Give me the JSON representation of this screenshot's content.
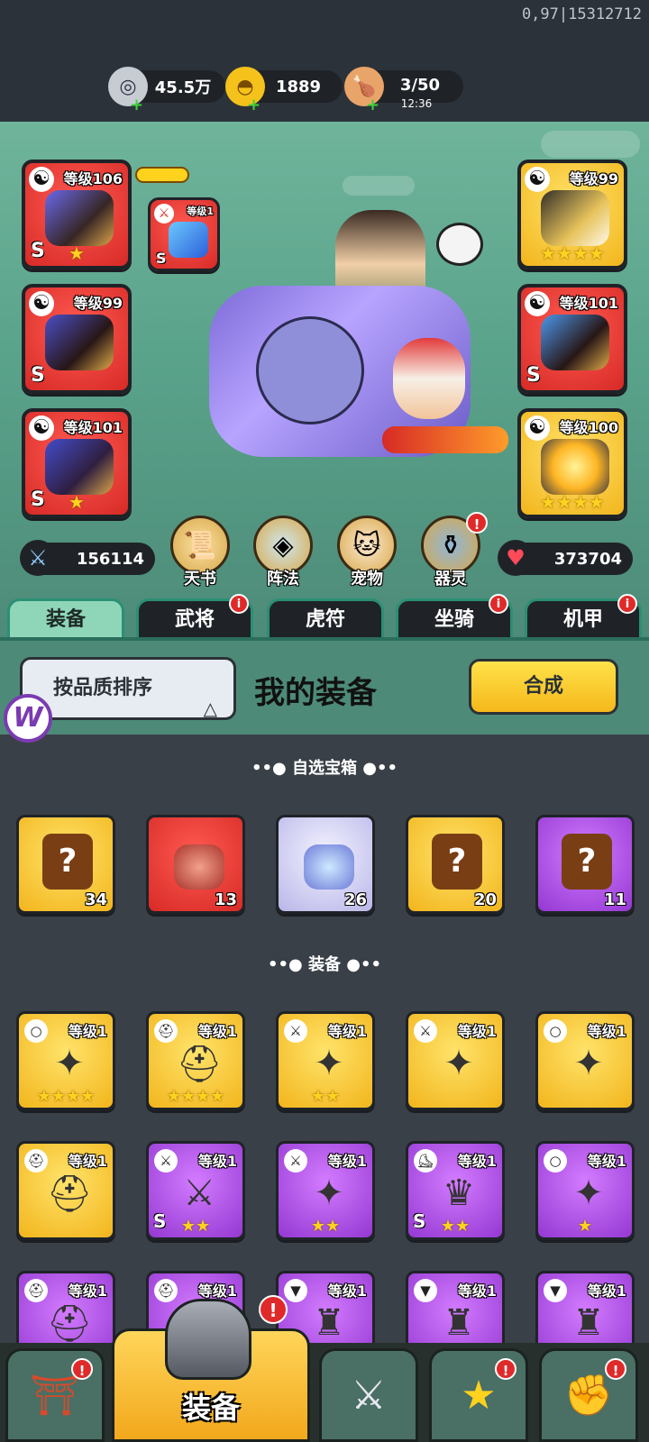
{
  "debug_text": "0,97|15312712",
  "resources": [
    {
      "icon": "coin-icon",
      "value": "45.5万"
    },
    {
      "icon": "gold-ingot-icon",
      "value": "1889"
    },
    {
      "icon": "drumstick-icon",
      "value": "3/50",
      "sub": "12:36"
    }
  ],
  "equip_slots_left": [
    {
      "level": "等级106",
      "grade": "S",
      "stars": "★",
      "color": "red"
    },
    {
      "level": "等级99",
      "grade": "S",
      "stars": "",
      "color": "red"
    },
    {
      "level": "等级101",
      "grade": "S",
      "stars": "★",
      "color": "red"
    }
  ],
  "small_slot": {
    "level": "等级1",
    "grade": "S"
  },
  "equip_slots_right": [
    {
      "level": "等级99",
      "grade": "",
      "stars": "★★★★",
      "color": "gold"
    },
    {
      "level": "等级101",
      "grade": "S",
      "stars": "",
      "color": "red"
    },
    {
      "level": "等级100",
      "grade": "",
      "stars": "★★★★",
      "color": "gold"
    }
  ],
  "stats": {
    "attack": "156114",
    "hp": "373704"
  },
  "features": [
    {
      "label": "天书",
      "icon": "scroll-icon",
      "badge": false
    },
    {
      "label": "阵法",
      "icon": "formation-icon",
      "badge": false
    },
    {
      "label": "宠物",
      "icon": "cat-icon",
      "badge": false
    },
    {
      "label": "器灵",
      "icon": "spirit-jar-icon",
      "badge": true
    }
  ],
  "tabs": [
    {
      "label": "装备",
      "active": true,
      "badge": false
    },
    {
      "label": "武将",
      "active": false,
      "badge": true
    },
    {
      "label": "虎符",
      "active": false,
      "badge": false
    },
    {
      "label": "坐骑",
      "active": false,
      "badge": true
    },
    {
      "label": "机甲",
      "active": false,
      "badge": true
    }
  ],
  "badge_glyph": "i",
  "alert_glyph": "!",
  "sort_button": "按品质排序",
  "sort_arrow": "△",
  "panel_title": "我的装备",
  "synth_button": "合成",
  "logo_letter": "W",
  "section_chests": "••● 自选宝箱 ●••",
  "chests": [
    {
      "color": "gold",
      "count": "34",
      "kind": "question"
    },
    {
      "color": "red",
      "count": "13",
      "kind": "pet"
    },
    {
      "color": "light",
      "count": "26",
      "kind": "hero"
    },
    {
      "color": "gold",
      "count": "20",
      "kind": "question"
    },
    {
      "color": "purple",
      "count": "11",
      "kind": "question"
    }
  ],
  "question_mark": "?",
  "section_equip": "••● 装备 ●••",
  "equipment": [
    {
      "color": "gold",
      "level": "等级1",
      "type": "○",
      "glyph": "✦",
      "grade": "",
      "stars": "★★★★"
    },
    {
      "color": "gold",
      "level": "等级1",
      "type": "⛑",
      "glyph": "⛑",
      "grade": "",
      "stars": "★★★★"
    },
    {
      "color": "gold",
      "level": "等级1",
      "type": "⚔",
      "glyph": "✦",
      "grade": "",
      "stars": "★★"
    },
    {
      "color": "gold",
      "level": "等级1",
      "type": "⚔",
      "glyph": "✦",
      "grade": "",
      "stars": ""
    },
    {
      "color": "gold",
      "level": "等级1",
      "type": "○",
      "glyph": "✦",
      "grade": "",
      "stars": ""
    },
    {
      "color": "gold",
      "level": "等级1",
      "type": "⛑",
      "glyph": "⛑",
      "grade": "",
      "stars": ""
    },
    {
      "color": "purple",
      "level": "等级1",
      "type": "⚔",
      "glyph": "⚔",
      "grade": "S",
      "stars": "★★"
    },
    {
      "color": "purple",
      "level": "等级1",
      "type": "⚔",
      "glyph": "✦",
      "grade": "",
      "stars": "★★"
    },
    {
      "color": "purple",
      "level": "等级1",
      "type": "⛸",
      "glyph": "♛",
      "grade": "S",
      "stars": "★★"
    },
    {
      "color": "purple",
      "level": "等级1",
      "type": "○",
      "glyph": "✦",
      "grade": "",
      "stars": "★"
    },
    {
      "color": "purple",
      "level": "等级1",
      "type": "⛑",
      "glyph": "⛑",
      "grade": "",
      "stars": ""
    },
    {
      "color": "purple",
      "level": "等级1",
      "type": "⛑",
      "glyph": "⛑",
      "grade": "",
      "stars": ""
    },
    {
      "color": "purple",
      "level": "等级1",
      "type": "▼",
      "glyph": "♜",
      "grade": "",
      "stars": ""
    },
    {
      "color": "purple",
      "level": "等级1",
      "type": "▼",
      "glyph": "♜",
      "grade": "",
      "stars": ""
    },
    {
      "color": "purple",
      "level": "等级1",
      "type": "▼",
      "glyph": "♜",
      "grade": "",
      "stars": ""
    }
  ],
  "bottom_nav": [
    {
      "icon": "shop-gate-icon",
      "badge": true,
      "active": false
    },
    {
      "label": "装备",
      "icon": "helmet-icon",
      "badge": true,
      "active": true
    },
    {
      "icon": "crossed-swords-icon",
      "badge": false,
      "active": false
    },
    {
      "icon": "battle-icon",
      "badge": true,
      "active": false
    },
    {
      "icon": "fist-upgrade-icon",
      "badge": true,
      "active": false
    }
  ],
  "colors": {
    "accent_gold": "#f5b81a",
    "scene_green": "#5aa38b",
    "badge_red": "#e02a2a"
  }
}
